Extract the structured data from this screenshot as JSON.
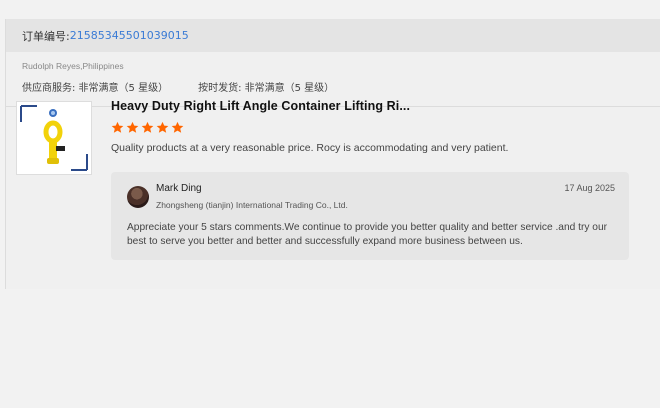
{
  "order": {
    "label": "订单编号:",
    "number": "21585345501039015"
  },
  "buyer": {
    "name_country": "Rudolph Reyes,Philippines"
  },
  "ratings": [
    {
      "text": "供应商服务: 非常满意（5 星级）"
    },
    {
      "text": "按时发货: 非常满意（5 星级）"
    }
  ],
  "product": {
    "title": "Heavy Duty Right Lift Angle Container Lifting Ri...",
    "stars": 5,
    "star_color": "#ff6600"
  },
  "review": {
    "text": "Quality products at a very reasonable price. Rocy is accommodating and very patient."
  },
  "reply": {
    "name": "Mark Ding",
    "company": "Zhongsheng (tianjin) International Trading Co., Ltd.",
    "date": "17 Aug 2025",
    "body": "Appreciate your 5 stars comments.We continue to provide you better quality and better service .and try  our best to serve you better and better and successfully expand more business between us."
  }
}
